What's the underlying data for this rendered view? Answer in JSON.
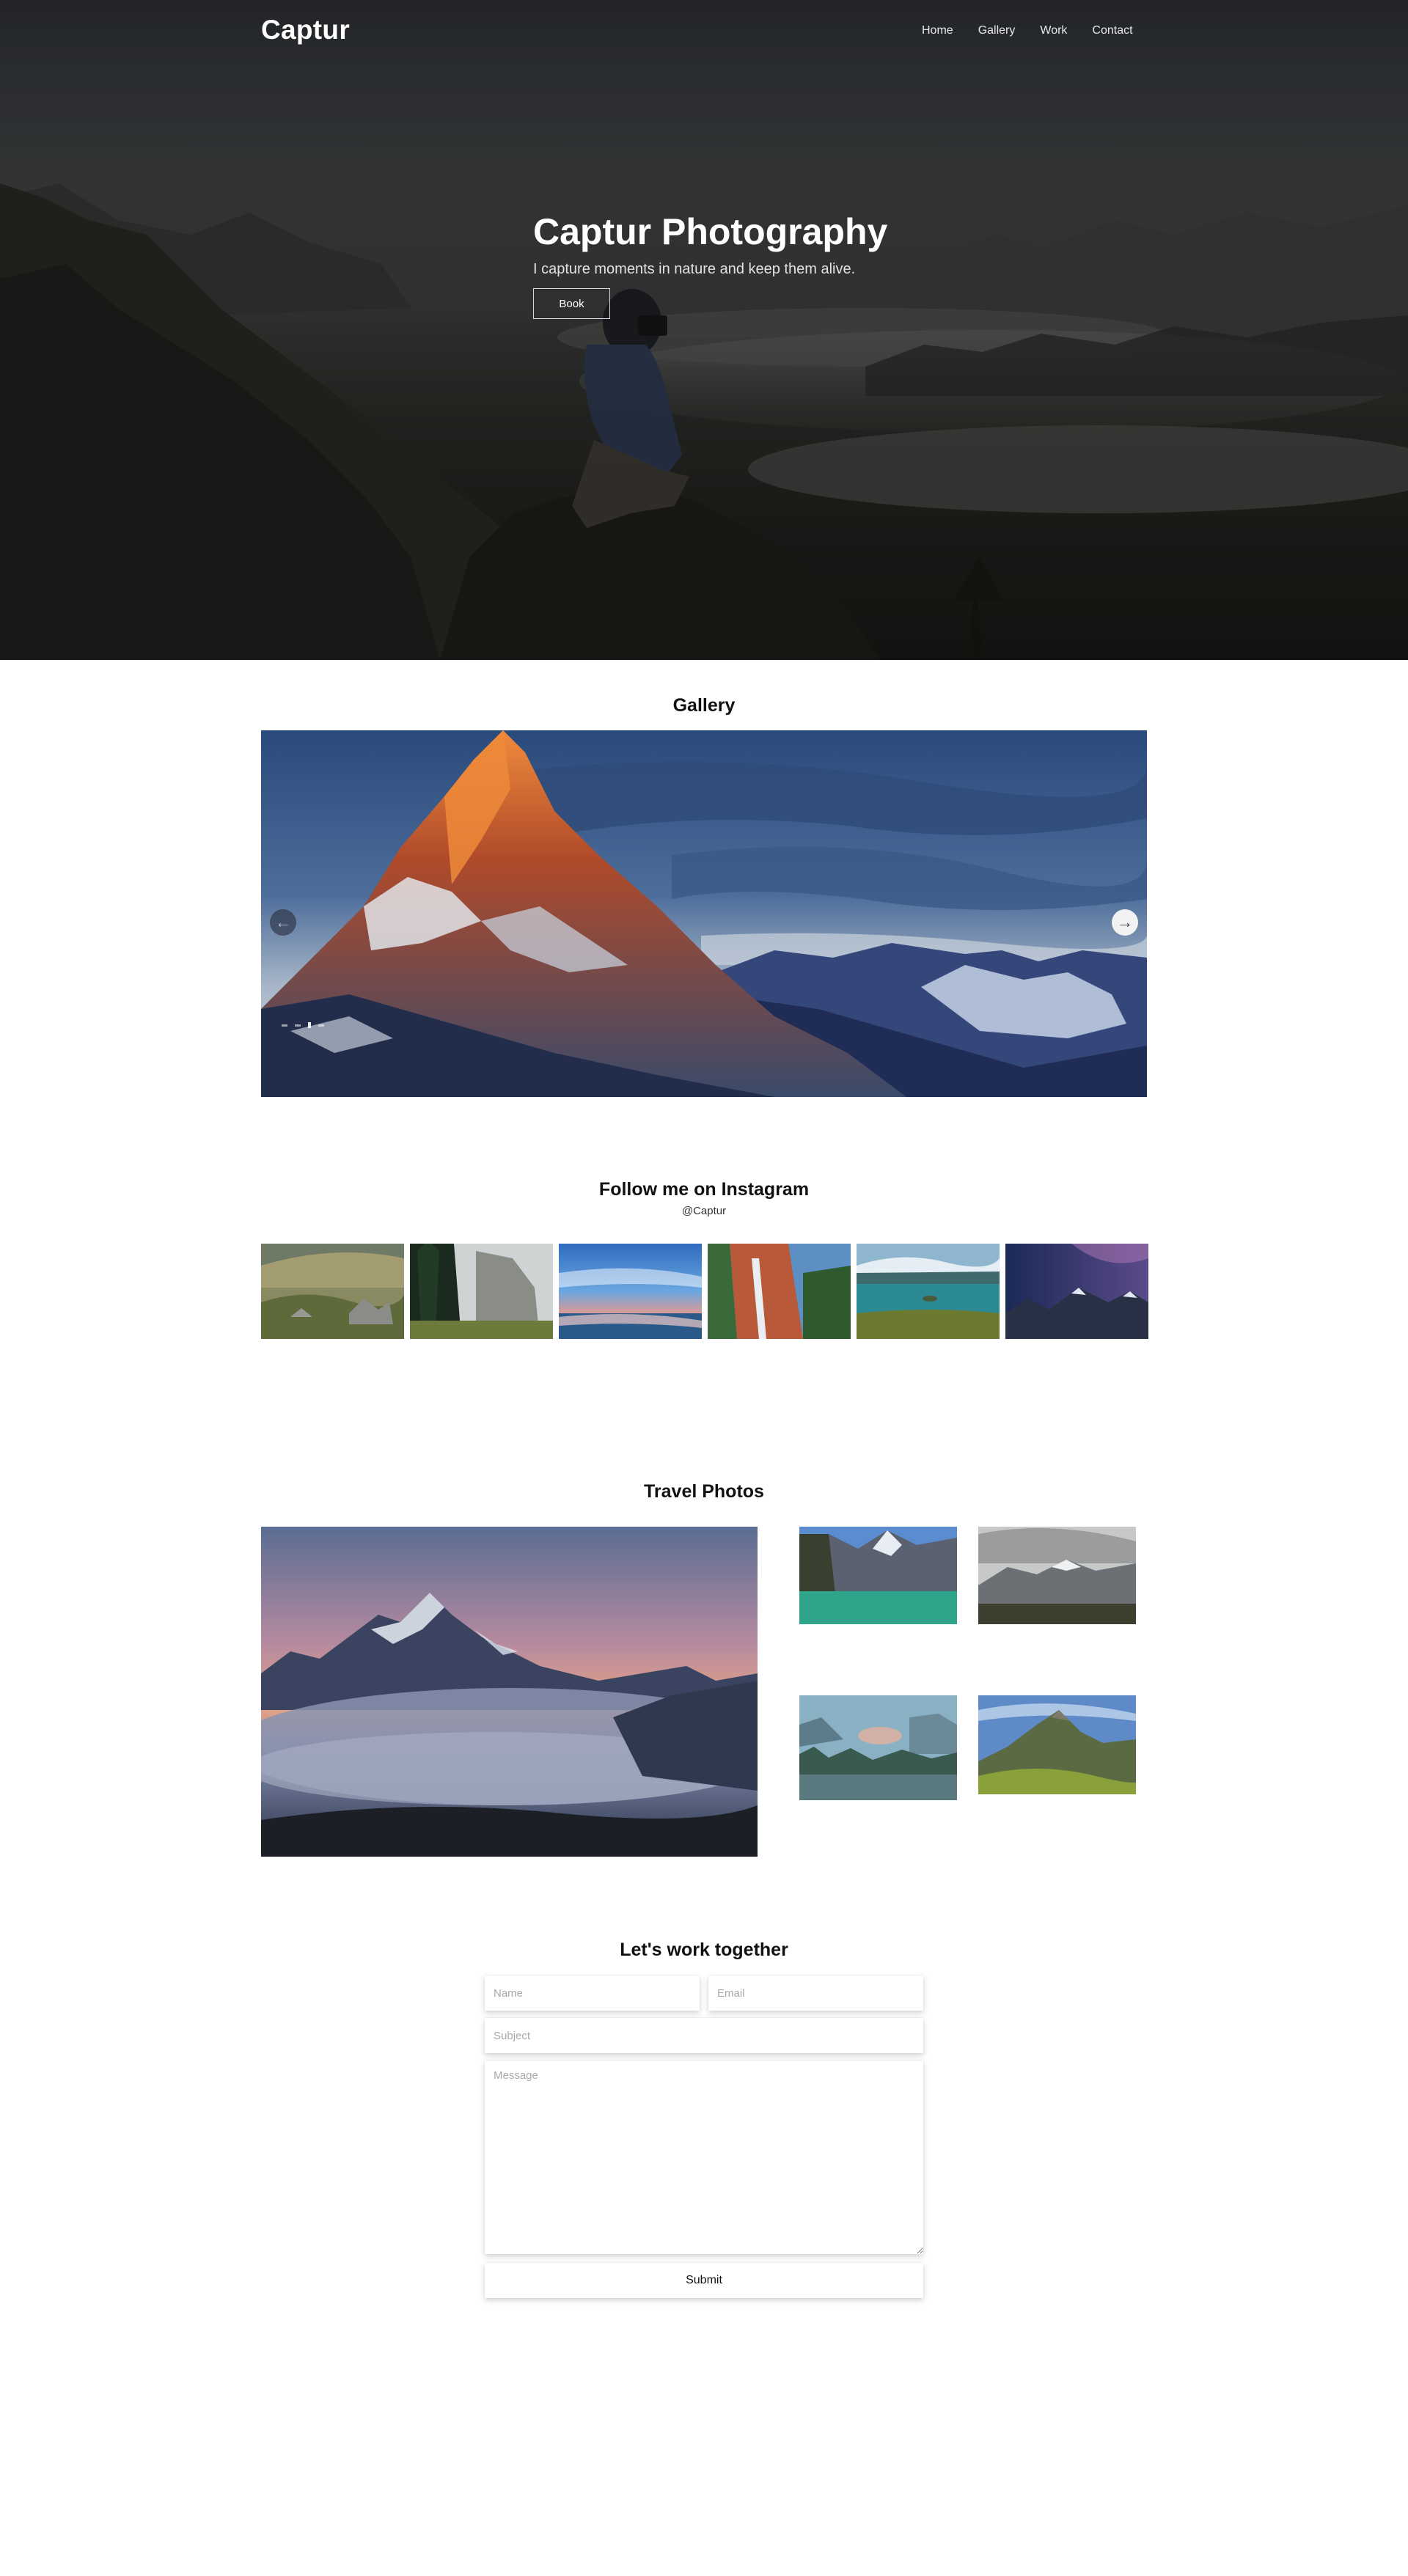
{
  "nav": {
    "brand": "Captur",
    "links": [
      "Home",
      "Gallery",
      "Work",
      "Contact"
    ]
  },
  "hero": {
    "title": "Captur Photography",
    "subtitle": "I capture moments in nature and keep them alive.",
    "button": "Book"
  },
  "gallery": {
    "title": "Gallery",
    "prev_icon": "arrow-left-icon",
    "next_icon": "arrow-right-icon",
    "slide_count": 4,
    "active_slide": 1
  },
  "instagram": {
    "title": "Follow me on Instagram",
    "handle": "@Captur",
    "photo_count": 6
  },
  "travel": {
    "title": "Travel Photos",
    "photo_count": 5
  },
  "contact": {
    "title": "Let's work together",
    "name_placeholder": "Name",
    "email_placeholder": "Email",
    "subject_placeholder": "Subject",
    "message_placeholder": "Message",
    "submit": "Submit"
  },
  "colors": {
    "background": "#ffffff",
    "text": "#111111",
    "hero_overlay": "#2b2c2e"
  }
}
